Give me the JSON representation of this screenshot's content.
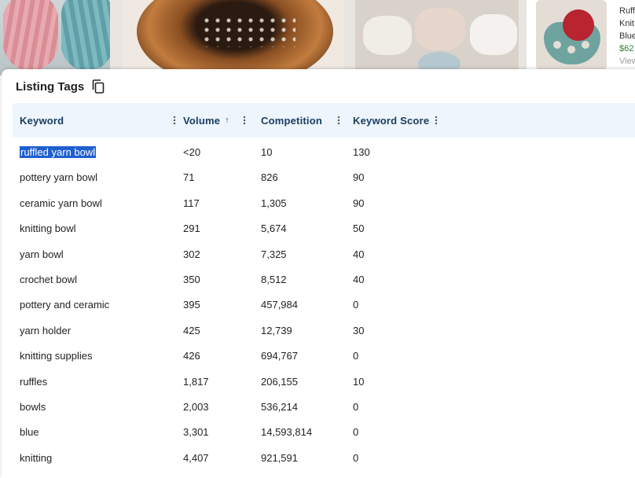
{
  "background": {
    "card": {
      "title_fragment": "Ruff",
      "line2": "Knit",
      "line3": "Blue",
      "price": "$62",
      "view": "View"
    }
  },
  "dialog": {
    "title": "Listing Tags",
    "copy_icon": "copy-icon"
  },
  "table": {
    "headers": {
      "keyword": "Keyword",
      "volume": "Volume",
      "volume_sort": "↑",
      "competition": "Competition",
      "score": "Keyword Score"
    },
    "rows": [
      {
        "keyword": "ruffled yarn bowl",
        "volume": "<20",
        "competition": "10",
        "score": "130"
      },
      {
        "keyword": "pottery yarn bowl",
        "volume": "71",
        "competition": "826",
        "score": "90"
      },
      {
        "keyword": "ceramic yarn bowl",
        "volume": "117",
        "competition": "1,305",
        "score": "90"
      },
      {
        "keyword": "knitting bowl",
        "volume": "291",
        "competition": "5,674",
        "score": "50"
      },
      {
        "keyword": "yarn bowl",
        "volume": "302",
        "competition": "7,325",
        "score": "40"
      },
      {
        "keyword": "crochet bowl",
        "volume": "350",
        "competition": "8,512",
        "score": "40"
      },
      {
        "keyword": "pottery and ceramic",
        "volume": "395",
        "competition": "457,984",
        "score": "0"
      },
      {
        "keyword": "yarn holder",
        "volume": "425",
        "competition": "12,739",
        "score": "30"
      },
      {
        "keyword": "knitting supplies",
        "volume": "426",
        "competition": "694,767",
        "score": "0"
      },
      {
        "keyword": "ruffles",
        "volume": "1,817",
        "competition": "206,155",
        "score": "10"
      },
      {
        "keyword": "bowls",
        "volume": "2,003",
        "competition": "536,214",
        "score": "0"
      },
      {
        "keyword": "blue",
        "volume": "3,301",
        "competition": "14,593,814",
        "score": "0"
      },
      {
        "keyword": "knitting",
        "volume": "4,407",
        "competition": "921,591",
        "score": "0"
      }
    ]
  },
  "colors": {
    "header_bg": "#eef5fc",
    "header_text": "#1a3d63",
    "selection": "#1f5fcf",
    "price_green": "#2e7d32"
  }
}
